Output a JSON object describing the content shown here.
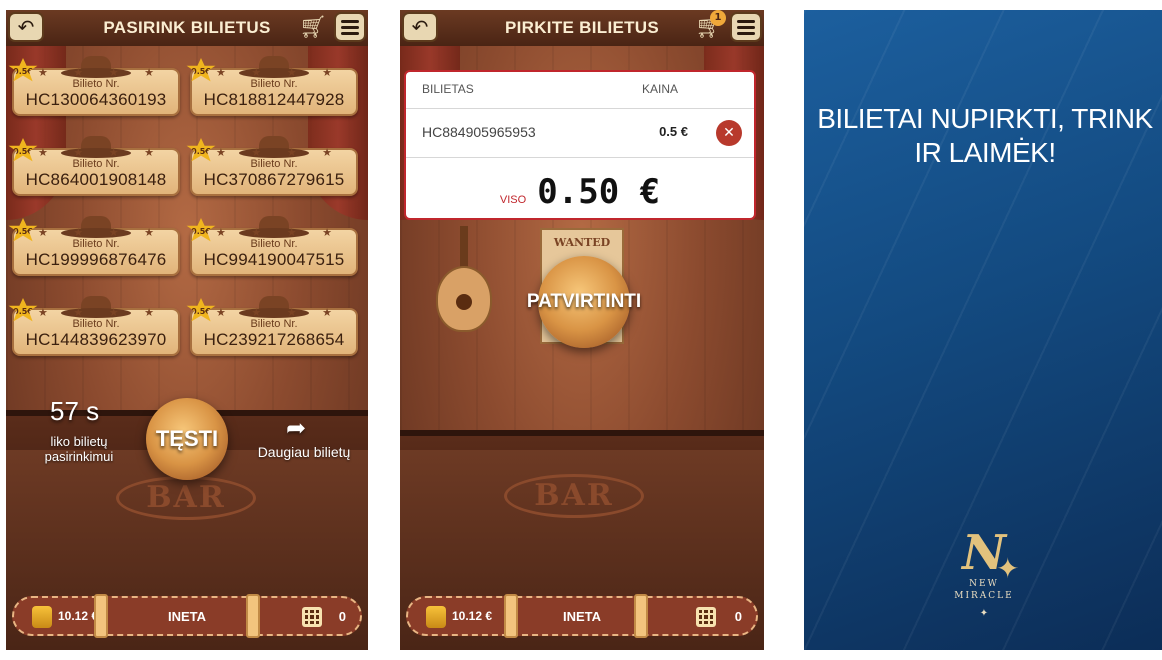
{
  "panel1": {
    "title": "PASIRINK BILIETUS",
    "back_icon": "back-arrow-icon",
    "cart_icon": "cart-icon",
    "menu_icon": "menu-icon",
    "ticket_label": "Bilieto Nr.",
    "ticket_price": "0.5€",
    "tickets": [
      "HC130064360193",
      "HC818812447928",
      "HC864001908148",
      "HC370867279615",
      "HC199996876476",
      "HC994190047515",
      "HC144839623970",
      "HC239217268654"
    ],
    "timer_value": "57 s",
    "timer_text": "liko bilietų pasirinkimui",
    "continue_label": "TĘSTI",
    "more_icon": "share-arrow-icon",
    "more_label": "Daugiau bilietų",
    "bar_sign": "BAR",
    "bottom": {
      "balance": "10.12 €",
      "label": "INETA",
      "count": "0"
    }
  },
  "panel2": {
    "title": "PIRKITE BILIETUS",
    "cart_badge": "1",
    "col_ticket": "BILIETAS",
    "col_price": "KAINA",
    "row_code": "HC884905965953",
    "row_price": "0.5 €",
    "remove_icon": "close-icon",
    "total_label": "VISO",
    "total_value": "0.50 €",
    "confirm_label": "PATVIRTINTI",
    "wanted_text": "WANTED",
    "bar_sign": "BAR",
    "bottom": {
      "balance": "10.12 €",
      "label": "INETA",
      "count": "0"
    }
  },
  "panel3": {
    "message": "BILIETAI NUPIRKTI, TRINK IR LAIMĖK!",
    "logo_text": "NEW MIRACLE",
    "logo_line1": "NEW",
    "logo_line2": "MIRACLE"
  },
  "colors": {
    "accent_red": "#c0262c",
    "wood": "#8c4b2f",
    "blue_bg": "#134a80",
    "gold": "#e2c27d"
  }
}
